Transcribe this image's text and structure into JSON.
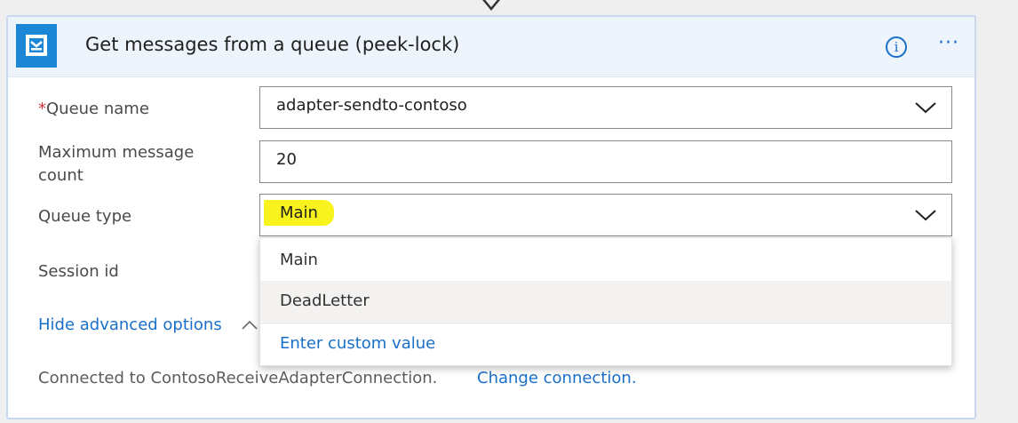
{
  "header": {
    "title": "Get messages from a queue (peek-lock)",
    "icon": "service-bus-queue-icon",
    "info_glyph": "i",
    "more_glyph": "···"
  },
  "fields": {
    "queue_name": {
      "required_marker": "*",
      "label": "Queue name",
      "value": "adapter-sendto-contoso"
    },
    "max_count": {
      "label_line1": "Maximum message",
      "label_line2": "count",
      "value": "20"
    },
    "queue_type": {
      "label": "Queue type",
      "value": "Main"
    },
    "session_id": {
      "label": "Session id"
    }
  },
  "dropdown": {
    "options": [
      "Main",
      "DeadLetter"
    ],
    "custom_value": "Enter custom value"
  },
  "advanced": {
    "label": "Hide advanced options"
  },
  "connection": {
    "text": "Connected to ContosoReceiveAdapterConnection.",
    "change_link": "Change connection."
  },
  "colors": {
    "accent": "#1a6fc9",
    "icon_bg": "#1c87d6",
    "highlight": "#f8f31d",
    "required": "#d13438"
  }
}
